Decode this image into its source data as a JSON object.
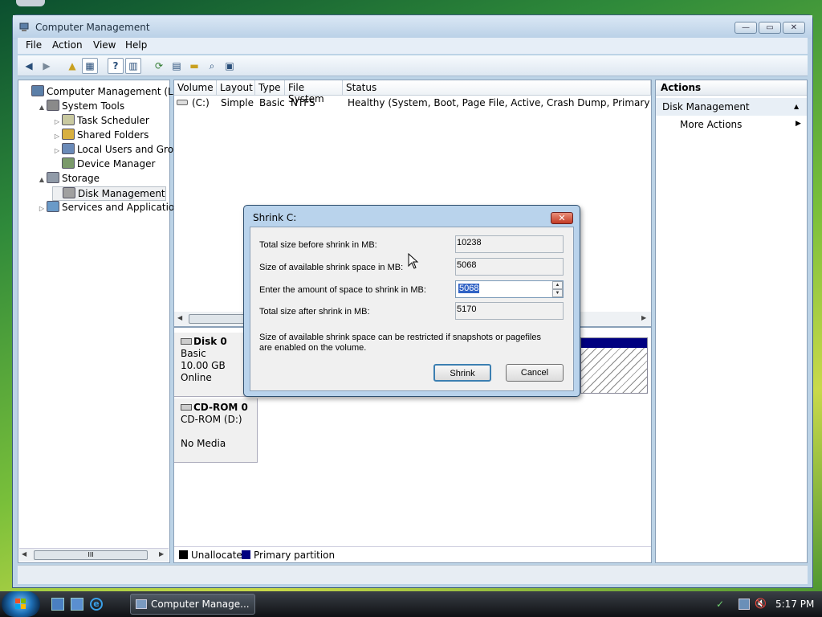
{
  "window": {
    "title": "Computer Management"
  },
  "menu": [
    "File",
    "Action",
    "View",
    "Help"
  ],
  "tree": {
    "items": [
      {
        "label": "Computer Management (Local",
        "indent": 0,
        "expander": "",
        "icon": "computer-icon"
      },
      {
        "label": "System Tools",
        "indent": 1,
        "expander": "▲",
        "icon": "tools-icon"
      },
      {
        "label": "Task Scheduler",
        "indent": 2,
        "expander": "▷",
        "icon": "clock-icon"
      },
      {
        "label": "Shared Folders",
        "indent": 2,
        "expander": "▷",
        "icon": "shared-folder-icon"
      },
      {
        "label": "Local Users and Groups",
        "indent": 2,
        "expander": "▷",
        "icon": "users-icon"
      },
      {
        "label": "Device Manager",
        "indent": 2,
        "expander": "",
        "icon": "device-manager-icon"
      },
      {
        "label": "Storage",
        "indent": 1,
        "expander": "▲",
        "icon": "storage-icon"
      },
      {
        "label": "Disk Management",
        "indent": 2,
        "expander": "",
        "icon": "disk-icon",
        "selected": true
      },
      {
        "label": "Services and Applications",
        "indent": 1,
        "expander": "▷",
        "icon": "services-icon"
      }
    ],
    "scroll_grip": "III"
  },
  "volumes": {
    "columns": [
      "Volume",
      "Layout",
      "Type",
      "File System",
      "Status"
    ],
    "rows": [
      [
        "(C:)",
        "Simple",
        "Basic",
        "NTFS",
        "Healthy (System, Boot, Page File, Active, Crash Dump, Primary Partition"
      ]
    ]
  },
  "disks": [
    {
      "name": "Disk 0",
      "type": "Basic",
      "size": "10.00 GB",
      "state": "Online"
    },
    {
      "name": "CD-ROM 0",
      "type": "CD-ROM (D:)",
      "size": "",
      "state": "No Media"
    }
  ],
  "legend": {
    "unallocated": "Unallocated",
    "primary": "Primary partition"
  },
  "actions": {
    "header": "Actions",
    "section": "Disk Management",
    "more": "More Actions"
  },
  "dialog": {
    "title": "Shrink C:",
    "total_before_label": "Total size before shrink in MB:",
    "total_before": "10238",
    "available_label": "Size of available shrink space in MB:",
    "available": "5068",
    "amount_label": "Enter the amount of space to shrink in MB:",
    "amount": "5068",
    "total_after_label": "Total size after shrink in MB:",
    "total_after": "5170",
    "note": "Size of available shrink space can be restricted if snapshots or pagefiles are enabled on the volume.",
    "shrink_label": "Shrink",
    "cancel_label": "Cancel"
  },
  "taskbar": {
    "task": "Computer Manage...",
    "clock": "5:17 PM"
  },
  "colors": {
    "primary_partition": "#000080",
    "unallocated": "#000000",
    "selection": "#3163c5"
  }
}
